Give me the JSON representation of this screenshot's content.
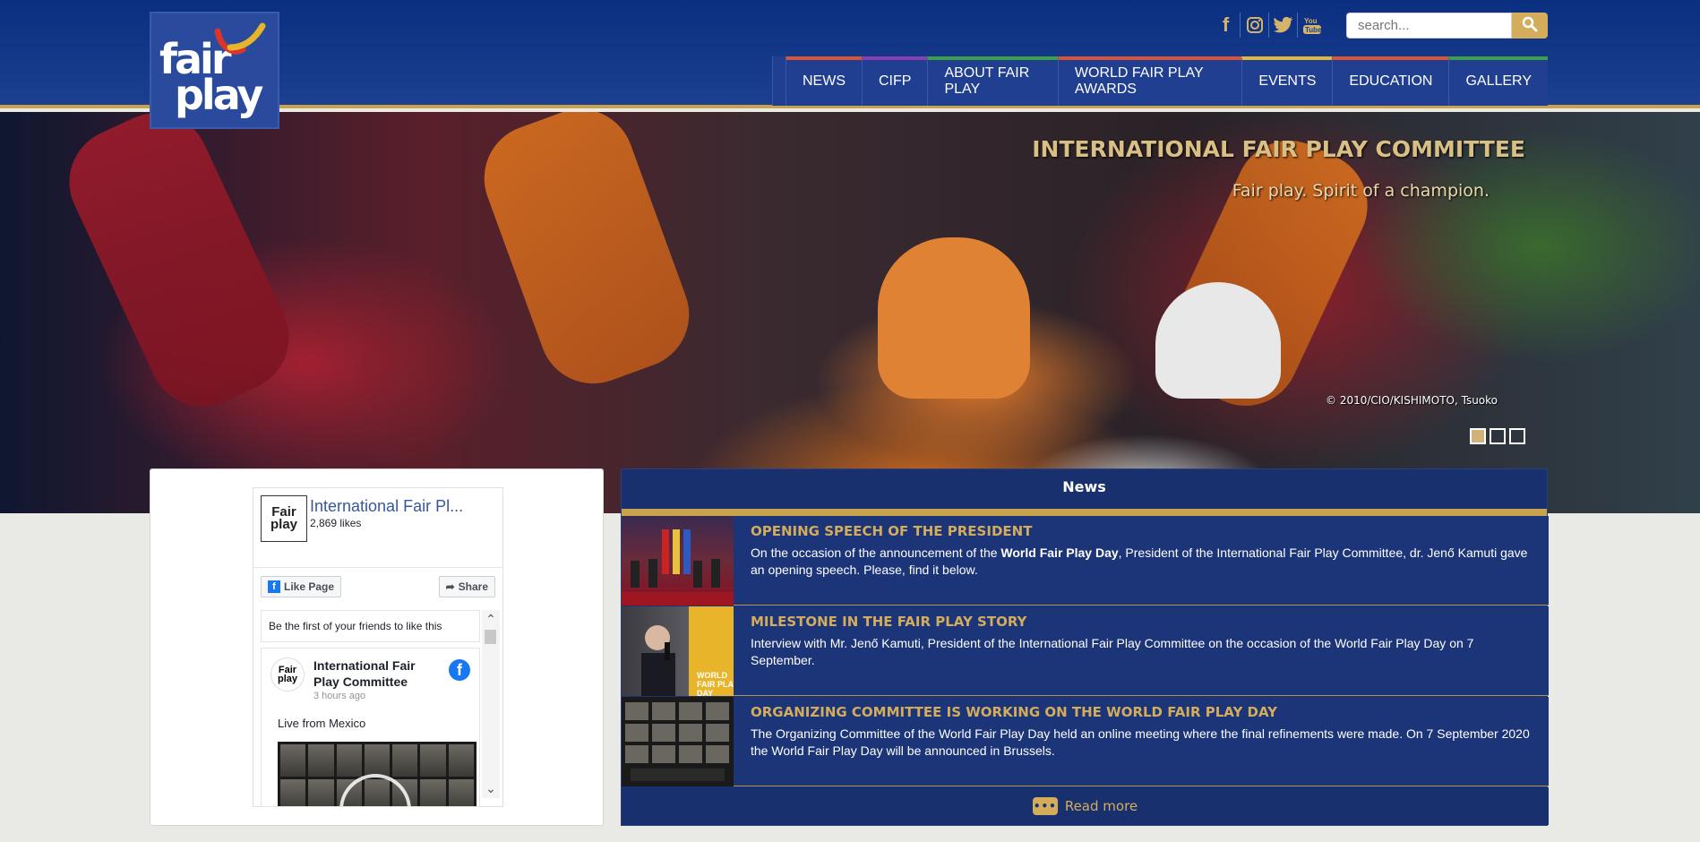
{
  "header": {
    "logo_line1": "fair",
    "logo_line2": "play",
    "social": [
      {
        "icon": "facebook-icon",
        "glyph": "f"
      },
      {
        "icon": "instagram-icon",
        "glyph": "◙"
      },
      {
        "icon": "twitter-icon",
        "glyph": "🐦"
      },
      {
        "icon": "youtube-icon",
        "glyph": "▶"
      }
    ],
    "search_placeholder": "search...",
    "nav": [
      {
        "label": "NEWS",
        "color": "#d9533a"
      },
      {
        "label": "CIFP",
        "color": "#8a3fb0"
      },
      {
        "label": "ABOUT FAIR PLAY",
        "color": "#3aa04a"
      },
      {
        "label": "WORLD FAIR PLAY AWARDS",
        "color": "#d9533a"
      },
      {
        "label": "EVENTS",
        "color": "#e0b73a"
      },
      {
        "label": "EDUCATION",
        "color": "#d9533a"
      },
      {
        "label": "GALLERY",
        "color": "#3aa04a"
      }
    ]
  },
  "hero": {
    "title": "INTERNATIONAL FAIR PLAY COMMITTEE",
    "subtitle": "Fair play. Spirit of a champion.",
    "credit": "© 2010/CIO/KISHIMOTO, Tsuoko"
  },
  "facebook": {
    "page_name": "International Fair Pl...",
    "likes": "2,869 likes",
    "like_button": "Like Page",
    "share_button": "Share",
    "friends_text": "Be the first of your friends to like this",
    "post": {
      "author": "International Fair Play Committee",
      "time": "3 hours ago",
      "text": "Live from Mexico"
    }
  },
  "news": {
    "heading": "News",
    "items": [
      {
        "title": "OPENING SPEECH OF THE PRESIDENT",
        "text_before": "On the occasion of the announcement of the ",
        "text_bold": "World Fair Play Day",
        "text_after": ", President of the International Fair Play Committee, dr. Jenő Kamuti gave an opening speech. Please, find it below."
      },
      {
        "title": "MILESTONE IN THE FAIR PLAY STORY",
        "text_before": "Interview with Mr. Jenő Kamuti, President of the International Fair Play Committee on the occasion of the World Fair Play Day on 7 September.",
        "text_bold": "",
        "text_after": ""
      },
      {
        "title": "ORGANIZING COMMITTEE IS WORKING ON THE WORLD FAIR PLAY DAY",
        "text_before": "The Organizing Committee of the World Fair Play Day held an online meeting where the final refinements were made. On 7 September 2020 the World Fair Play Day will be announced in Brussels.",
        "text_bold": "",
        "text_after": ""
      }
    ],
    "read_more": "Read more"
  },
  "colors": {
    "brand_blue": "#1c3f90",
    "gold": "#c9a24d"
  }
}
